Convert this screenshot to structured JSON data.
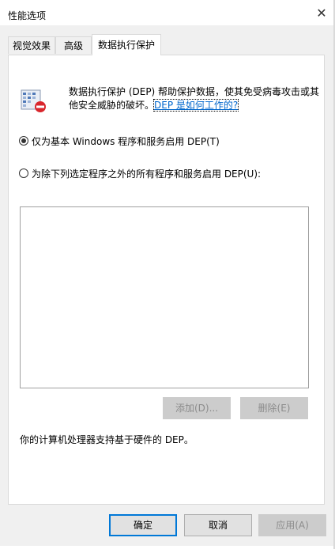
{
  "window": {
    "title": "性能选项",
    "close_glyph": "✕"
  },
  "tabs": [
    {
      "label": "视觉效果"
    },
    {
      "label": "高级"
    },
    {
      "label": "数据执行保护",
      "active": true
    }
  ],
  "dep": {
    "description": "数据执行保护 (DEP) 帮助保护数据，使其免受病毒攻击或其他安全威胁的破坏。",
    "link": "DEP 是如何工作的?",
    "option_essential": "仅为基本 Windows 程序和服务启用 DEP(T)",
    "option_all_except": "为除下列选定程序之外的所有程序和服务启用 DEP(U):",
    "selected_option": "essential",
    "add_button": "添加(D)...",
    "remove_button": "删除(E)",
    "support_text": "你的计算机处理器支持基于硬件的 DEP。"
  },
  "footer": {
    "ok": "确定",
    "cancel": "取消",
    "apply": "应用(A)"
  },
  "colors": {
    "accent": "#0078d7",
    "link": "#0066cc",
    "icon_red": "#d9262c"
  }
}
